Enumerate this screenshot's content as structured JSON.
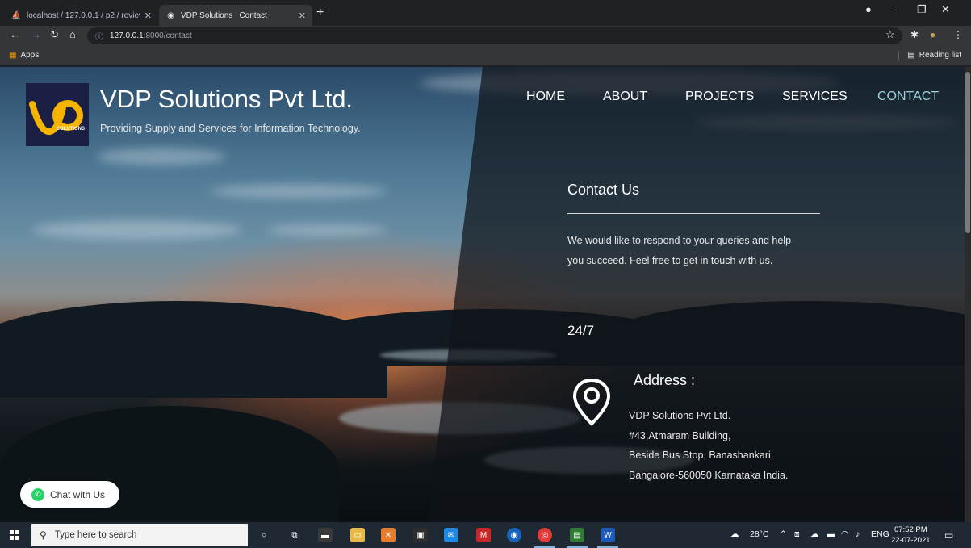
{
  "browser": {
    "tabs": [
      {
        "title": "localhost / 127.0.0.1 / p2 / review",
        "active": false
      },
      {
        "title": "VDP Solutions | Contact",
        "active": true
      }
    ],
    "url_host": "127.0.0.1",
    "url_rest": ":8000/contact",
    "bookmarks": {
      "apps": "Apps",
      "reading_list": "Reading list"
    }
  },
  "site": {
    "brand": "VDP Solutions Pvt Ltd.",
    "tagline": "Providing Supply and Services for Information Technology.",
    "logo_text": "SOLUTIONS",
    "nav": [
      "HOME",
      "ABOUT",
      "PROJECTS",
      "SERVICES",
      "CONTACT"
    ],
    "active_nav": "CONTACT"
  },
  "contact": {
    "title": "Contact Us",
    "description_line1": "We would like to respond to your queries and help",
    "description_line2": "you succeed. Feel free to get in touch with us.",
    "hours": "24/7",
    "address_title": "Address :",
    "address_lines": [
      "VDP Solutions Pvt Ltd.",
      "#43,Atmaram Building,",
      "Beside Bus Stop, Banashankari,",
      "Bangalore-560050 Karnataka India."
    ]
  },
  "chat": {
    "label": "Chat with Us"
  },
  "taskbar": {
    "search_placeholder": "Type here to search",
    "weather": "28°C",
    "language": "ENG",
    "time": "07:52 PM",
    "date": "22-07-2021"
  },
  "colors": {
    "active_nav": "#9fd3d9",
    "logo_bg": "#1c1f44",
    "logo_gold": "#f5b400",
    "chat_green": "#25d366"
  }
}
